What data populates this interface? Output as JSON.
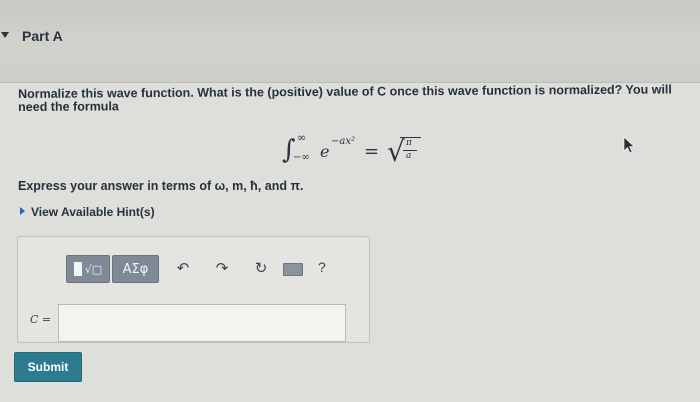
{
  "part": {
    "title": "Part A"
  },
  "question": {
    "text": "Normalize this wave function. What is the (positive) value of C once this wave function is normalized? You will need the formula",
    "express_answer": "Express your answer in terms of ω, m, ħ, and π."
  },
  "formula": {
    "integral": "∫",
    "upper_limit": "∞",
    "lower_limit": "−∞",
    "base": "e",
    "exponent": "−ax²",
    "equals": "=",
    "sqrt": "√",
    "numerator": "π",
    "denominator": "a",
    "period": "."
  },
  "hints": {
    "label": "View Available Hint(s)"
  },
  "toolbar": {
    "templates_label": "√□",
    "symbols_label": "ΑΣφ",
    "undo_glyph": "↶",
    "redo_glyph": "↷",
    "reset_glyph": "↻",
    "help_label": "?"
  },
  "answer": {
    "variable_label": "C =",
    "value": ""
  },
  "submit": {
    "label": "Submit"
  },
  "colors": {
    "submit_button": "#2d7b8e",
    "toolbar_button": "#7f8a96",
    "link_arrow": "#2a66b0"
  }
}
